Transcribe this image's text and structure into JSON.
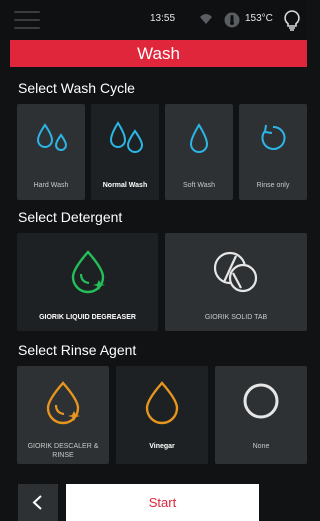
{
  "status": {
    "time": "13:55",
    "temperature": "153°C"
  },
  "header": {
    "title": "Wash"
  },
  "wash_cycle": {
    "title": "Select Wash Cycle",
    "options": [
      "Hard Wash",
      "Normal Wash",
      "Soft Wash",
      "Rinse only"
    ],
    "selected": "Normal Wash"
  },
  "detergent": {
    "title": "Select Detergent",
    "options": [
      "GIORIK LIQUID DEGREASER",
      "GIORIK SOLID TAB"
    ],
    "selected": "GIORIK LIQUID DEGREASER"
  },
  "rinse_agent": {
    "title": "Select Rinse Agent",
    "options": [
      "GIORIK DESCALER & RINSE",
      "Vinegar",
      "None"
    ],
    "selected": "Vinegar"
  },
  "footer": {
    "start_label": "Start"
  },
  "colors": {
    "brand_red": "#e0263a",
    "cyan": "#2bb6e6",
    "green": "#23c05a",
    "orange": "#e6961e"
  }
}
